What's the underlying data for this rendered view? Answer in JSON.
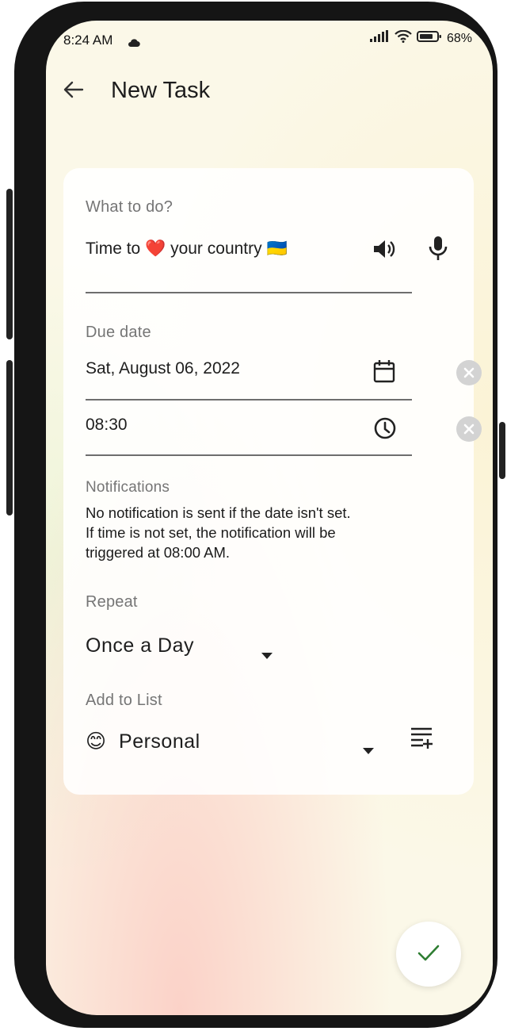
{
  "status_bar": {
    "time": "8:24 AM",
    "battery": "68%",
    "icons": [
      "signal-icon",
      "wifi-icon",
      "battery-icon"
    ]
  },
  "app_bar": {
    "title": "New Task",
    "back_icon": "arrow-back-icon"
  },
  "task": {
    "label": "What to do?",
    "value_before": "Time to",
    "value_heart": "❤️",
    "value_after": "your country",
    "value_flag": "🇺🇦",
    "icons": [
      "speaker-icon",
      "microphone-icon"
    ]
  },
  "due": {
    "label": "Due date",
    "date_value": "Sat, August 06, 2022",
    "time_value": "08:30",
    "icons": [
      "calendar-icon",
      "clock-icon",
      "clear-icon"
    ]
  },
  "notifications": {
    "label": "Notifications",
    "line1": "No notification is sent if the date isn't set.",
    "line2": "If time is not set, the notification will be",
    "line3": "triggered at 08:00 AM."
  },
  "repeat": {
    "label": "Repeat",
    "selected": "Once a Day"
  },
  "list": {
    "label": "Add to List",
    "emoji": "😊",
    "selected": "Personal",
    "icons": [
      "dropdown-arrow-icon",
      "add-list-icon"
    ]
  },
  "fab": {
    "icon": "check-icon",
    "color": "#2e7d32"
  },
  "colors": {
    "accent": "#2e7d32",
    "label": "#757575",
    "text": "#1e1e1e"
  }
}
